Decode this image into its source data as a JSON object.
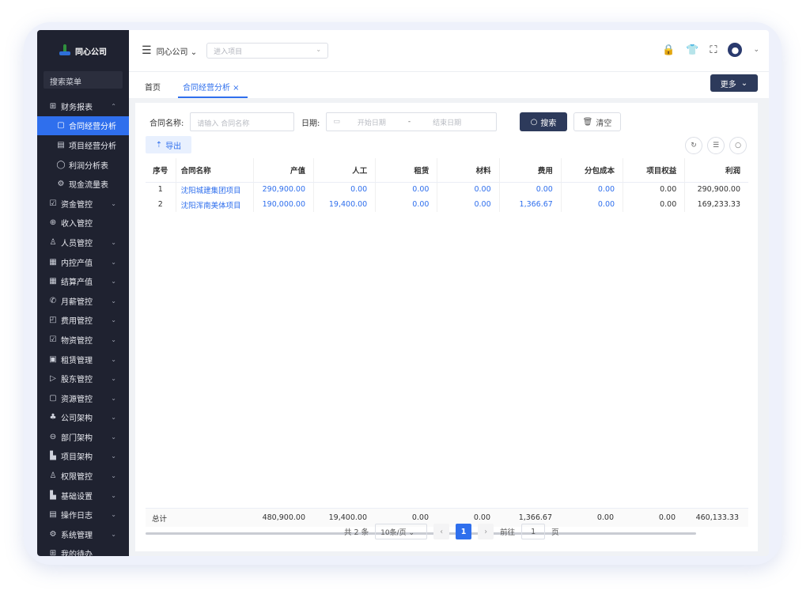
{
  "app": {
    "logo_text": "同心公司"
  },
  "sidebar": {
    "search_label": "搜索菜单",
    "items": [
      {
        "icon": "grid-icon",
        "glyph": "⊞",
        "label": "财务报表",
        "chev": "⌃",
        "type": "group"
      },
      {
        "icon": "doc-icon",
        "glyph": "▢",
        "label": "合同经营分析",
        "type": "sub",
        "active": true
      },
      {
        "icon": "doc-icon",
        "glyph": "▤",
        "label": "项目经营分析",
        "type": "sub"
      },
      {
        "icon": "pin-icon",
        "glyph": "◯",
        "label": "利润分析表",
        "type": "sub"
      },
      {
        "icon": "gear-icon",
        "glyph": "⚙",
        "label": "现金流量表",
        "type": "sub"
      },
      {
        "icon": "check-icon",
        "glyph": "☑",
        "label": "资金管控",
        "chev": "⌄"
      },
      {
        "icon": "coin-icon",
        "glyph": "⊕",
        "label": "收入管控"
      },
      {
        "icon": "user-icon",
        "glyph": "♙",
        "label": "人员管控",
        "chev": "⌄"
      },
      {
        "icon": "table-icon",
        "glyph": "▦",
        "label": "内控产值",
        "chev": "⌄"
      },
      {
        "icon": "table-icon",
        "glyph": "▦",
        "label": "结算产值",
        "chev": "⌄"
      },
      {
        "icon": "phone-icon",
        "glyph": "✆",
        "label": "月薪管控",
        "chev": "⌄"
      },
      {
        "icon": "wallet-icon",
        "glyph": "◰",
        "label": "费用管控",
        "chev": "⌄"
      },
      {
        "icon": "check-icon",
        "glyph": "☑",
        "label": "物资管控",
        "chev": "⌄"
      },
      {
        "icon": "lease-icon",
        "glyph": "▣",
        "label": "租赁管理",
        "chev": "⌄"
      },
      {
        "icon": "send-icon",
        "glyph": "▷",
        "label": "股东管控",
        "chev": "⌄"
      },
      {
        "icon": "box-icon",
        "glyph": "▢",
        "label": "资源管控",
        "chev": "⌄"
      },
      {
        "icon": "org-icon",
        "glyph": "♣",
        "label": "公司架构",
        "chev": "⌄"
      },
      {
        "icon": "minus-icon",
        "glyph": "⊖",
        "label": "部门架构",
        "chev": "⌄"
      },
      {
        "icon": "chart-icon",
        "glyph": "▙",
        "label": "项目架构",
        "chev": "⌄"
      },
      {
        "icon": "user-icon",
        "glyph": "♙",
        "label": "权限管控",
        "chev": "⌄"
      },
      {
        "icon": "chart-icon",
        "glyph": "▙",
        "label": "基础设置",
        "chev": "⌄"
      },
      {
        "icon": "doc-icon",
        "glyph": "▤",
        "label": "操作日志",
        "chev": "⌄"
      },
      {
        "icon": "gear-icon",
        "glyph": "⚙",
        "label": "系统管理",
        "chev": "⌄"
      },
      {
        "icon": "grid-icon",
        "glyph": "⊞",
        "label": "我的待办",
        "chev": ""
      }
    ]
  },
  "header": {
    "company": "同心公司 ⌄",
    "project_placeholder": "进入项目",
    "project_arrow": "⌄"
  },
  "tabs": {
    "home": "首页",
    "active": "合同经营分析 ×",
    "more_label": "更多"
  },
  "filters": {
    "contract_label": "合同名称:",
    "contract_placeholder": "请输入 合同名称",
    "date_label": "日期:",
    "start_placeholder": "开始日期",
    "sep": "-",
    "end_placeholder": "结束日期",
    "search_label": "搜索",
    "clear_label": "清空",
    "export_label": "导出"
  },
  "table": {
    "headers": [
      "序号",
      "合同名称",
      "产值",
      "人工",
      "租赁",
      "材料",
      "费用",
      "分包成本",
      "项目权益",
      "利润"
    ],
    "rows": [
      [
        "1",
        "沈阳城建集团项目",
        "290,900.00",
        "0.00",
        "0.00",
        "0.00",
        "0.00",
        "0.00",
        "0.00",
        "290,900.00"
      ],
      [
        "2",
        "沈阳浑南美体项目",
        "190,000.00",
        "19,400.00",
        "0.00",
        "0.00",
        "1,366.67",
        "0.00",
        "0.00",
        "169,233.33"
      ]
    ],
    "totals": [
      "总计",
      "",
      "480,900.00",
      "19,400.00",
      "0.00",
      "0.00",
      "1,366.67",
      "0.00",
      "0.00",
      "460,133.33"
    ]
  },
  "pager": {
    "total": "共 2 条",
    "size": "10条/页",
    "page": "1",
    "goto": "前往",
    "goto_value": "1",
    "page_unit": "页"
  }
}
